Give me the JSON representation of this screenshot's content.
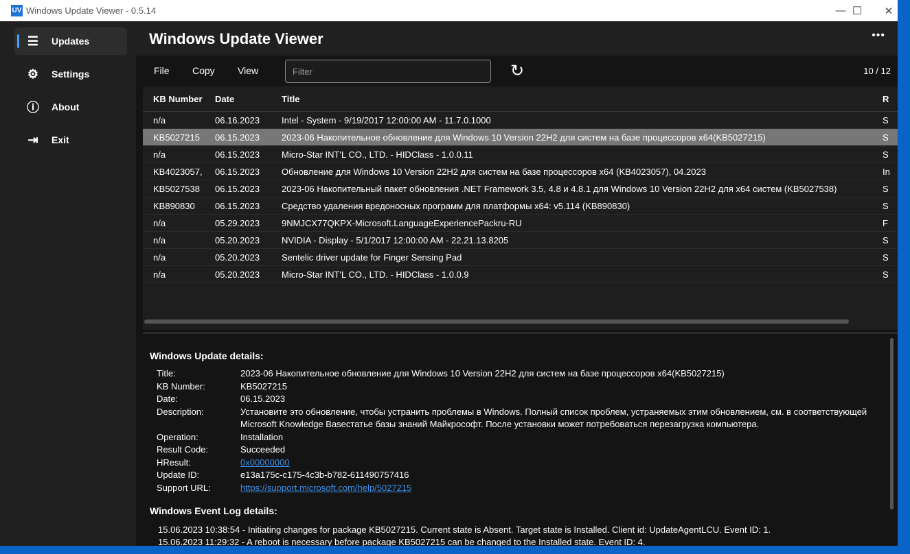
{
  "window": {
    "title": "Windows Update Viewer - 0.5.14",
    "icon_text": "UV"
  },
  "sidebar": {
    "items": [
      {
        "label": "Updates",
        "icon": "list-icon",
        "active": true
      },
      {
        "label": "Settings",
        "icon": "gear-icon"
      },
      {
        "label": "About",
        "icon": "info-icon"
      },
      {
        "label": "Exit",
        "icon": "exit-icon"
      }
    ]
  },
  "header": {
    "title": "Windows Update Viewer",
    "more": "•••"
  },
  "toolbar": {
    "file": "File",
    "copy": "Copy",
    "view": "View",
    "filter_placeholder": "Filter",
    "filter_value": "",
    "count": "10 / 12"
  },
  "table": {
    "columns": [
      "KB Number",
      "Date",
      "Title",
      "R"
    ],
    "rows": [
      [
        "n/a",
        "06.16.2023",
        "Intel - System - 9/19/2017 12:00:00 AM - 11.7.0.1000",
        "S"
      ],
      [
        "KB5027215",
        "06.15.2023",
        "2023-06 Накопительное обновление для Windows 10 Version 22H2 для систем на базе процессоров x64(KB5027215)",
        "S"
      ],
      [
        "n/a",
        "06.15.2023",
        "Micro-Star INT'L CO., LTD. - HIDClass - 1.0.0.11",
        "S"
      ],
      [
        "KB4023057,",
        "06.15.2023",
        "Обновление для Windows 10 Version 22H2 для систем на базе процессоров x64 (KB4023057), 04.2023",
        "In"
      ],
      [
        "KB5027538",
        "06.15.2023",
        "2023-06 Накопительный пакет обновления .NET Framework 3.5, 4.8 и 4.8.1 для Windows 10 Version 22H2 для x64 систем (KB5027538)",
        "S"
      ],
      [
        "KB890830",
        "06.15.2023",
        "Средство удаления вредоносных программ для платформы x64: v5.114 (KB890830)",
        "S"
      ],
      [
        "n/a",
        "05.29.2023",
        "9NMJCX77QKPX-Microsoft.LanguageExperiencePackru-RU",
        "F"
      ],
      [
        "n/a",
        "05.20.2023",
        "NVIDIA - Display - 5/1/2017 12:00:00 AM - 22.21.13.8205",
        "S"
      ],
      [
        "n/a",
        "05.20.2023",
        "Sentelic driver update for Finger Sensing Pad",
        "S"
      ],
      [
        "n/a",
        "05.20.2023",
        "Micro-Star INT'L CO., LTD. - HIDClass - 1.0.0.9",
        "S"
      ]
    ],
    "selected_index": 1
  },
  "details": {
    "heading": "Windows Update details:",
    "fields": [
      {
        "k": "Title:",
        "v": "2023-06 Накопительное обновление для Windows 10 Version 22H2 для систем на базе процессоров x64(KB5027215)"
      },
      {
        "k": "KB Number:",
        "v": "KB5027215"
      },
      {
        "k": "Date:",
        "v": "06.15.2023"
      },
      {
        "k": "Description:",
        "v": "Установите это обновление, чтобы устранить проблемы в Windows. Полный список проблем, устраняемых этим обновлением, см. в соответствующей Microsoft Knowledge Baseстатье базы знаний Майкрософт. После установки может потребоваться перезагрузка компьютера."
      },
      {
        "k": "Operation:",
        "v": "Installation"
      },
      {
        "k": "Result Code:",
        "v": "Succeeded"
      },
      {
        "k": "HResult:",
        "v": "0x00000000",
        "link": true
      },
      {
        "k": "Update ID:",
        "v": "e13a175c-c175-4c3b-b782-611490757416"
      },
      {
        "k": "Support URL:",
        "v": "https://support.microsoft.com/help/5027215",
        "link": true
      }
    ],
    "log_heading": "Windows Event Log details:",
    "log": [
      "15.06.2023 10:38:54 - Initiating changes for package KB5027215. Current state is Absent. Target state is Installed. Client id: UpdateAgentLCU.  Event ID: 1.",
      "15.06.2023 11:29:32 - A reboot is necessary before package KB5027215 can be changed to the Installed state.  Event ID: 4."
    ]
  },
  "colors": {
    "accent": "#4a9eff",
    "link": "#3b8ee8",
    "selected_row": "#777777"
  }
}
